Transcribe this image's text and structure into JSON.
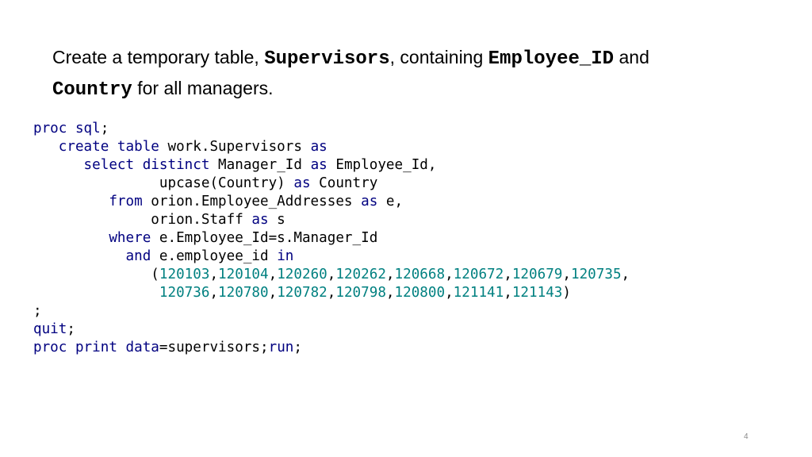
{
  "title": {
    "part1": "Create a temporary table, ",
    "table_name": "Supervisors",
    "part2": ", containing ",
    "col1": "Employee_ID",
    "part3": " and",
    "col2": "Country",
    "part4": " for all managers."
  },
  "colors": {
    "keyword": "#000080",
    "number": "#008080",
    "text": "#000000"
  },
  "code_lines": [
    [
      {
        "t": "proc sql",
        "c": "kw"
      },
      {
        "t": ";",
        "c": "tx"
      }
    ],
    [
      {
        "t": "   create table ",
        "c": "kw"
      },
      {
        "t": "work.Supervisors ",
        "c": "tx"
      },
      {
        "t": "as",
        "c": "kw"
      }
    ],
    [
      {
        "t": "      select distinct ",
        "c": "kw"
      },
      {
        "t": "Manager_Id ",
        "c": "tx"
      },
      {
        "t": "as",
        "c": "kw"
      },
      {
        "t": " Employee_Id,",
        "c": "tx"
      }
    ],
    [
      {
        "t": "               upcase(Country) ",
        "c": "tx"
      },
      {
        "t": "as",
        "c": "kw"
      },
      {
        "t": " Country",
        "c": "tx"
      }
    ],
    [
      {
        "t": "         from ",
        "c": "kw"
      },
      {
        "t": "orion.Employee_Addresses ",
        "c": "tx"
      },
      {
        "t": "as",
        "c": "kw"
      },
      {
        "t": " e,",
        "c": "tx"
      }
    ],
    [
      {
        "t": "              orion.Staff ",
        "c": "tx"
      },
      {
        "t": "as",
        "c": "kw"
      },
      {
        "t": " s",
        "c": "tx"
      }
    ],
    [
      {
        "t": "         where ",
        "c": "kw"
      },
      {
        "t": "e.Employee_Id=s.Manager_Id",
        "c": "tx"
      }
    ],
    [
      {
        "t": "           and ",
        "c": "kw"
      },
      {
        "t": "e.employee_id ",
        "c": "tx"
      },
      {
        "t": "in",
        "c": "kw"
      }
    ],
    [
      {
        "t": "              (",
        "c": "tx"
      },
      {
        "t": "120103",
        "c": "num"
      },
      {
        "t": ",",
        "c": "tx"
      },
      {
        "t": "120104",
        "c": "num"
      },
      {
        "t": ",",
        "c": "tx"
      },
      {
        "t": "120260",
        "c": "num"
      },
      {
        "t": ",",
        "c": "tx"
      },
      {
        "t": "120262",
        "c": "num"
      },
      {
        "t": ",",
        "c": "tx"
      },
      {
        "t": "120668",
        "c": "num"
      },
      {
        "t": ",",
        "c": "tx"
      },
      {
        "t": "120672",
        "c": "num"
      },
      {
        "t": ",",
        "c": "tx"
      },
      {
        "t": "120679",
        "c": "num"
      },
      {
        "t": ",",
        "c": "tx"
      },
      {
        "t": "120735",
        "c": "num"
      },
      {
        "t": ",",
        "c": "tx"
      }
    ],
    [
      {
        "t": "               ",
        "c": "tx"
      },
      {
        "t": "120736",
        "c": "num"
      },
      {
        "t": ",",
        "c": "tx"
      },
      {
        "t": "120780",
        "c": "num"
      },
      {
        "t": ",",
        "c": "tx"
      },
      {
        "t": "120782",
        "c": "num"
      },
      {
        "t": ",",
        "c": "tx"
      },
      {
        "t": "120798",
        "c": "num"
      },
      {
        "t": ",",
        "c": "tx"
      },
      {
        "t": "120800",
        "c": "num"
      },
      {
        "t": ",",
        "c": "tx"
      },
      {
        "t": "121141",
        "c": "num"
      },
      {
        "t": ",",
        "c": "tx"
      },
      {
        "t": "121143",
        "c": "num"
      },
      {
        "t": ")",
        "c": "tx"
      }
    ],
    [
      {
        "t": ";",
        "c": "tx"
      }
    ],
    [
      {
        "t": "quit",
        "c": "kw"
      },
      {
        "t": ";",
        "c": "tx"
      }
    ],
    [
      {
        "t": "proc print ",
        "c": "kw"
      },
      {
        "t": "data",
        "c": "kw"
      },
      {
        "t": "=supervisors;",
        "c": "tx"
      },
      {
        "t": "run",
        "c": "kw"
      },
      {
        "t": ";",
        "c": "tx"
      }
    ]
  ],
  "page_number": "4"
}
